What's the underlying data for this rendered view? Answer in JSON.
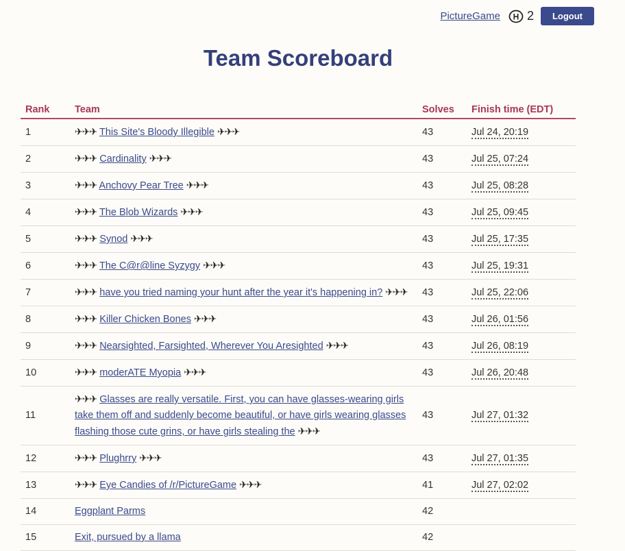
{
  "header": {
    "team_link": "PictureGame",
    "hint_icon_letter": "H",
    "hint_count": "2",
    "logout_label": "Logout"
  },
  "page": {
    "title": "Team Scoreboard"
  },
  "table": {
    "columns": {
      "rank": "Rank",
      "team": "Team",
      "solves": "Solves",
      "finish": "Finish time (EDT)"
    },
    "rows": [
      {
        "rank": "1",
        "team": "This Site's Bloody Illegible",
        "finisher": true,
        "solves": "43",
        "finish": "Jul 24, 20:19"
      },
      {
        "rank": "2",
        "team": "Cardinality",
        "finisher": true,
        "solves": "43",
        "finish": "Jul 25, 07:24"
      },
      {
        "rank": "3",
        "team": "Anchovy Pear Tree",
        "finisher": true,
        "solves": "43",
        "finish": "Jul 25, 08:28"
      },
      {
        "rank": "4",
        "team": "The Blob Wizards",
        "finisher": true,
        "solves": "43",
        "finish": "Jul 25, 09:45"
      },
      {
        "rank": "5",
        "team": "Synod",
        "finisher": true,
        "solves": "43",
        "finish": "Jul 25, 17:35"
      },
      {
        "rank": "6",
        "team": "The C@r@line Syzygy",
        "finisher": true,
        "solves": "43",
        "finish": "Jul 25, 19:31"
      },
      {
        "rank": "7",
        "team": "have you tried naming your hunt after the year it's happening in?",
        "finisher": true,
        "solves": "43",
        "finish": "Jul 25, 22:06"
      },
      {
        "rank": "8",
        "team": "Killer Chicken Bones",
        "finisher": true,
        "solves": "43",
        "finish": "Jul 26, 01:56"
      },
      {
        "rank": "9",
        "team": "Nearsighted, Farsighted, Wherever You Aresighted",
        "finisher": true,
        "solves": "43",
        "finish": "Jul 26, 08:19"
      },
      {
        "rank": "10",
        "team": "moderATE Myopia",
        "finisher": true,
        "solves": "43",
        "finish": "Jul 26, 20:48"
      },
      {
        "rank": "11",
        "team": "Glasses are really versatile. First, you can have glasses-wearing girls take them off and suddenly become beautiful, or have girls wearing glasses flashing those cute grins, or have girls stealing the",
        "finisher": true,
        "solves": "43",
        "finish": "Jul 27, 01:32"
      },
      {
        "rank": "12",
        "team": "Plughrry",
        "finisher": true,
        "solves": "43",
        "finish": "Jul 27, 01:35"
      },
      {
        "rank": "13",
        "team": "Eye Candies of /r/PictureGame",
        "finisher": true,
        "solves": "41",
        "finish": "Jul 27, 02:02"
      },
      {
        "rank": "14",
        "team": "Eggplant Parms",
        "finisher": false,
        "solves": "42",
        "finish": ""
      },
      {
        "rank": "15",
        "team": "Exit, pursued by a llama",
        "finisher": false,
        "solves": "42",
        "finish": ""
      }
    ]
  },
  "icons": {
    "finisher_marker": "airplane-icon",
    "hint": "hint-circle-icon"
  },
  "colors": {
    "accent": "#3b4a8c",
    "header_text": "#a8365a",
    "background": "#fdfcf8"
  }
}
